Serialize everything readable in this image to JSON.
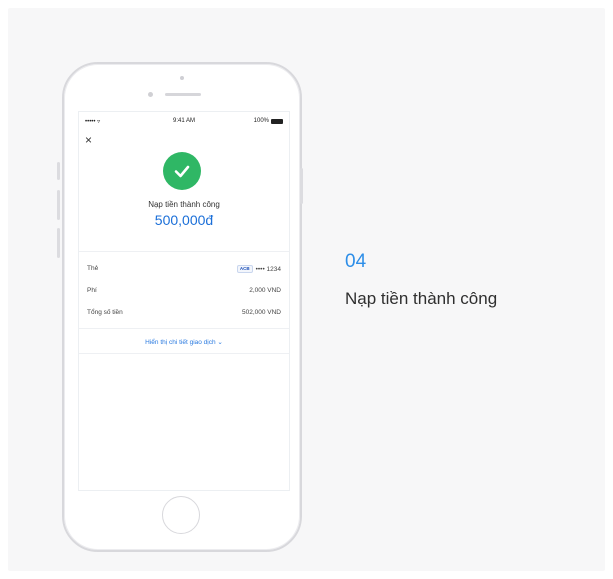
{
  "phone": {
    "status_bar": {
      "signal": "••••• ▿",
      "time": "9:41 AM",
      "battery": "100%"
    },
    "close_icon": "×",
    "success_title": "Nạp tiền thành công",
    "amount": "500,000đ",
    "details": [
      {
        "label": "Thẻ",
        "value": "•••• 1234",
        "badge": "ACB"
      },
      {
        "label": "Phí",
        "value": "2,000 VND"
      },
      {
        "label": "Tổng số tiền",
        "value": "502,000 VND"
      }
    ],
    "detail_link": "Hiển thị chi tiết giao dịch ⌄"
  },
  "step": {
    "number": "04",
    "label": "Nạp tiền thành công"
  },
  "colors": {
    "success": "#2fb765",
    "accent": "#1b6fd8",
    "step_number": "#2d8ee8"
  }
}
